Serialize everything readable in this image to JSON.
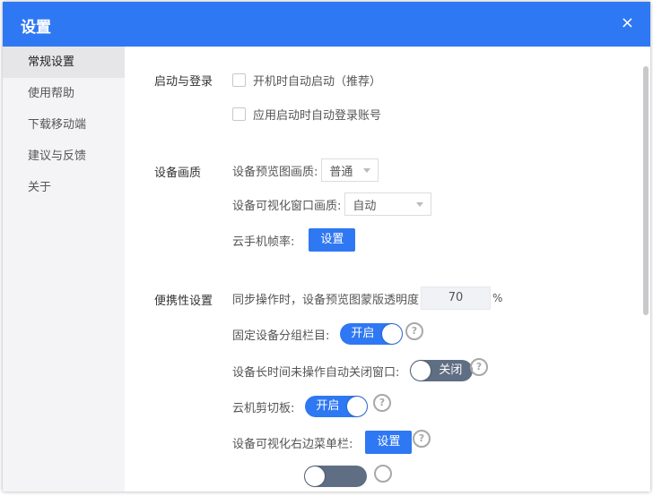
{
  "window": {
    "title": "设置",
    "close_icon": "×"
  },
  "sidebar": {
    "items": [
      {
        "label": "常规设置",
        "active": true
      },
      {
        "label": "使用帮助",
        "active": false
      },
      {
        "label": "下载移动端",
        "active": false
      },
      {
        "label": "建议与反馈",
        "active": false
      },
      {
        "label": "关于",
        "active": false
      }
    ]
  },
  "startup": {
    "section_label": "启动与登录",
    "auto_start_label": "开机时自动启动（推荐）",
    "auto_login_label": "应用启动时自动登录账号"
  },
  "quality": {
    "section_label": "设备画质",
    "preview_quality_label": "设备预览图画质:",
    "preview_quality_value": "普通",
    "visual_window_quality_label": "设备可视化窗口画质:",
    "visual_window_quality_value": "自动",
    "frame_rate_label": "云手机帧率:",
    "frame_rate_button": "设置"
  },
  "convenience": {
    "section_label": "便携性设置",
    "sync_opacity_label": "同步操作时，设备预览图蒙版透明度",
    "sync_opacity_value": "70",
    "sync_opacity_unit": "%",
    "fix_group_bar_label": "固定设备分组栏目:",
    "fix_group_bar_state": "开启",
    "auto_close_label": "设备长时间未操作自动关闭窗口:",
    "auto_close_state": "关闭",
    "clipboard_label": "云机剪切板:",
    "clipboard_state": "开启",
    "right_menu_label": "设备可视化右边菜单栏:",
    "right_menu_button": "设置",
    "help_icon": "?"
  },
  "colors": {
    "accent": "#2f78f3",
    "toggle_off": "#5f6e83",
    "sidebar_bg": "#f4f4f6"
  }
}
